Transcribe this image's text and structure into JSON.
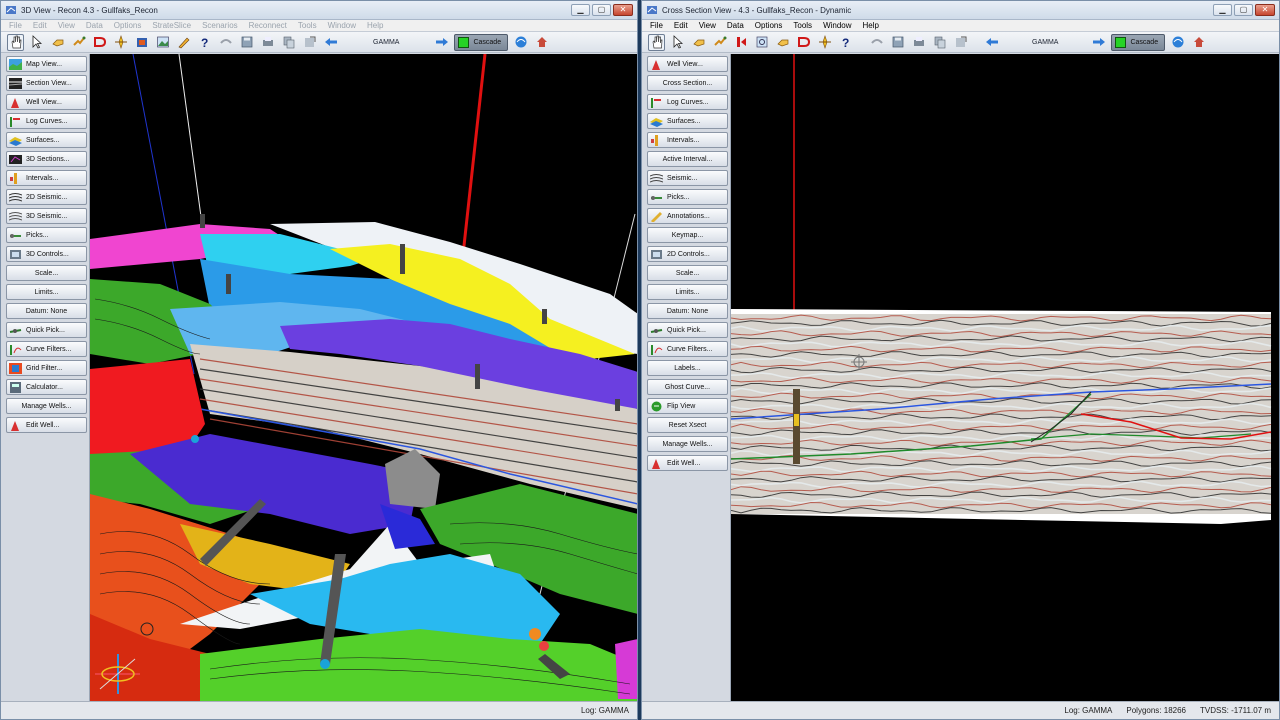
{
  "left_window": {
    "title": "3D View - Recon 4.3 - Gullfaks_Recon",
    "menu": [
      "File",
      "Edit",
      "View",
      "Data",
      "Options",
      "StrateSlice",
      "Scenarios",
      "Reconnect",
      "Tools",
      "Window",
      "Help"
    ],
    "toolbar_log": "GAMMA",
    "cascade": "Cascade",
    "panel_buttons": [
      {
        "label": "Map View...",
        "icon": "map-icon"
      },
      {
        "label": "Section View...",
        "icon": "section-icon"
      },
      {
        "label": "Well View...",
        "icon": "well-icon"
      },
      {
        "label": "Log Curves...",
        "icon": "log-curve-icon"
      },
      {
        "label": "Surfaces...",
        "icon": "surfaces-icon"
      },
      {
        "label": "3D Sections...",
        "icon": "3d-sections-icon"
      },
      {
        "label": "Intervals...",
        "icon": "intervals-icon"
      },
      {
        "label": "2D Seismic...",
        "icon": "seismic-2d-icon"
      },
      {
        "label": "3D Seismic...",
        "icon": "seismic-3d-icon"
      },
      {
        "label": "Picks...",
        "icon": "picks-icon"
      },
      {
        "label": "3D Controls...",
        "icon": "controls-3d-icon"
      },
      {
        "label": "Scale...",
        "icon": ""
      },
      {
        "label": "Limits...",
        "icon": ""
      },
      {
        "label": "Datum: None",
        "icon": ""
      },
      {
        "label": "Quick Pick...",
        "icon": "quick-pick-icon"
      },
      {
        "label": "Curve Filters...",
        "icon": "curve-filters-icon"
      },
      {
        "label": "Grid Filter...",
        "icon": "grid-filter-icon"
      },
      {
        "label": "Calculator...",
        "icon": "calculator-icon"
      },
      {
        "label": "Manage Wells...",
        "icon": ""
      },
      {
        "label": "Edit Well...",
        "icon": "edit-well-icon"
      }
    ],
    "status": {
      "log": "Log: GAMMA"
    }
  },
  "right_window": {
    "title": "Cross Section View - 4.3 - Gullfaks_Recon - Dynamic",
    "menu": [
      "File",
      "Edit",
      "View",
      "Data",
      "Options",
      "Tools",
      "Window",
      "Help"
    ],
    "toolbar_log": "GAMMA",
    "cascade": "Cascade",
    "panel_buttons": [
      {
        "label": "Well View...",
        "icon": "well-icon"
      },
      {
        "label": "Cross Section...",
        "icon": ""
      },
      {
        "label": "Log Curves...",
        "icon": "log-curve-icon"
      },
      {
        "label": "Surfaces...",
        "icon": "surfaces-icon"
      },
      {
        "label": "Intervals...",
        "icon": "intervals-icon"
      },
      {
        "label": "Active Interval...",
        "icon": ""
      },
      {
        "label": "Seismic...",
        "icon": "seismic-icon"
      },
      {
        "label": "Picks...",
        "icon": "picks-icon"
      },
      {
        "label": "Annotations...",
        "icon": "annotations-icon"
      },
      {
        "label": "Keymap...",
        "icon": ""
      },
      {
        "label": "2D Controls...",
        "icon": "controls-2d-icon"
      },
      {
        "label": "Scale...",
        "icon": ""
      },
      {
        "label": "Limits...",
        "icon": ""
      },
      {
        "label": "Datum: None",
        "icon": ""
      },
      {
        "label": "Quick Pick...",
        "icon": "quick-pick-icon"
      },
      {
        "label": "Curve Filters...",
        "icon": "curve-filters-icon"
      },
      {
        "label": "Labels...",
        "icon": ""
      },
      {
        "label": "Ghost Curve...",
        "icon": ""
      },
      {
        "label": "Flip View",
        "icon": "flip-view-icon"
      },
      {
        "label": "Reset Xsect",
        "icon": ""
      },
      {
        "label": "Manage Wells...",
        "icon": ""
      },
      {
        "label": "Edit Well...",
        "icon": "edit-well-icon"
      }
    ],
    "status": {
      "log": "Log: GAMMA",
      "polygons": "Polygons: 18266",
      "tvdss": "TVDSS: -1711.07 m"
    }
  },
  "window_buttons": {
    "minimize": "▁",
    "maximize": "▢",
    "close": "✕"
  },
  "colors": {
    "accent_green": "#26d326",
    "well_red": "#e01010",
    "horizon_blue": "#2b56e0"
  }
}
